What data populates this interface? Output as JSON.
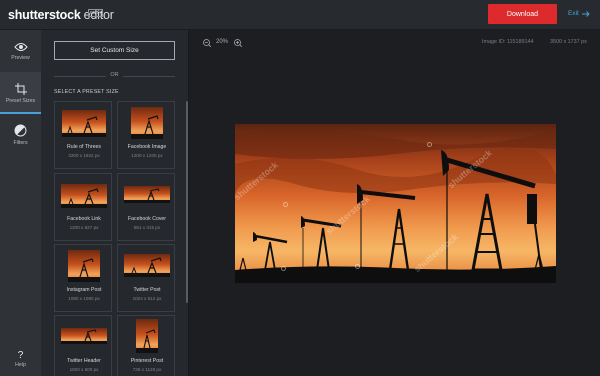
{
  "app": {
    "logo_text": "shutterstock",
    "editor_text": "editor",
    "beta_text": "BETA"
  },
  "header": {
    "download_label": "Download",
    "exit_label": "Exit",
    "download_color": "#dd2a2c",
    "exit_color": "#4aa3d8"
  },
  "rail": {
    "items": [
      {
        "label": "Preview",
        "icon": "eye-icon"
      },
      {
        "label": "Preset Sizes",
        "icon": "crop-icon"
      },
      {
        "label": "Filters",
        "icon": "filters-icon"
      }
    ],
    "help_label": "Help",
    "help_icon_glyph": "?"
  },
  "panel": {
    "custom_button_label": "Set Custom Size",
    "or_text": "OR",
    "section_label": "SELECT A PRESET SIZE",
    "presets": [
      {
        "name": "Rule of Threes",
        "dims": "3200 x 1922 px"
      },
      {
        "name": "Facebook Image",
        "dims": "1200 x 1200 px"
      },
      {
        "name": "Facebook Link",
        "dims": "1200 x 627 px"
      },
      {
        "name": "Facebook Cover",
        "dims": "851 x 315 px"
      },
      {
        "name": "Instagram Post",
        "dims": "1080 x 1080 px"
      },
      {
        "name": "Twitter Post",
        "dims": "1024 x 512 px"
      },
      {
        "name": "Twitter Header",
        "dims": "1500 x 500 px"
      },
      {
        "name": "Pinterest Post",
        "dims": "736 x 1128 px"
      }
    ]
  },
  "canvas": {
    "zoom_value": "20%",
    "image_id": "Image ID: 115189144",
    "image_size": "3500 x 1737 px",
    "watermark_text": "shutterstock"
  }
}
